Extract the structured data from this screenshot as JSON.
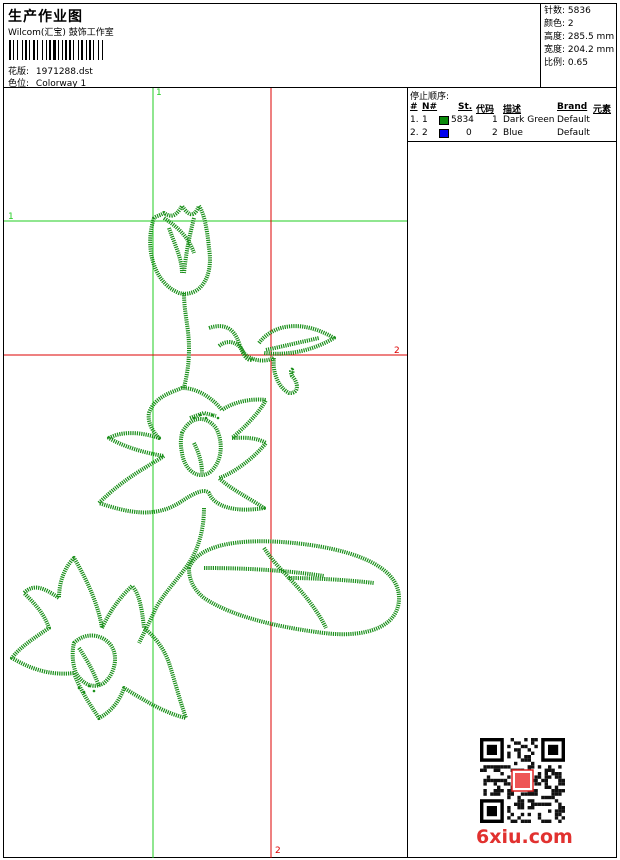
{
  "header": {
    "title": "生产作业图",
    "company": "Wilcom(汇宝) 鼓饰工作室",
    "design_label": "花版:",
    "design_value": "1971288.dst",
    "color_label": "色位:",
    "color_value": "Colorway 1"
  },
  "stats": {
    "stitches_label": "针数:",
    "stitches_value": "5836",
    "colors_label": "颜色:",
    "colors_value": "2",
    "height_label": "高度:",
    "height_value": "285.5 mm",
    "width_label": "宽度:",
    "width_value": "204.2 mm",
    "scale_label": "比例:",
    "scale_value": "0.65"
  },
  "stop_sequence": {
    "title": "停止顺序:",
    "columns": [
      "#",
      "N#",
      "St.",
      "代码",
      "描述",
      "Brand",
      "元素"
    ],
    "rows": [
      {
        "idx": "1.",
        "n": "1",
        "color": "#0a8a0a",
        "st": "5834",
        "code": "1",
        "desc": "Dark Green",
        "brand": "Default"
      },
      {
        "idx": "2.",
        "n": "2",
        "color": "#0000ee",
        "st": "0",
        "code": "2",
        "desc": "Blue",
        "brand": "Default"
      }
    ]
  },
  "guides": {
    "green_v": "1",
    "green_h": "1",
    "red_h": "2",
    "red_v": "2"
  },
  "colors": {
    "thread": "#1a8f1a",
    "guide_green": "#22cc22",
    "guide_red": "#dd0000",
    "watermark": "#e1312f"
  },
  "watermark": "6xiu.com"
}
